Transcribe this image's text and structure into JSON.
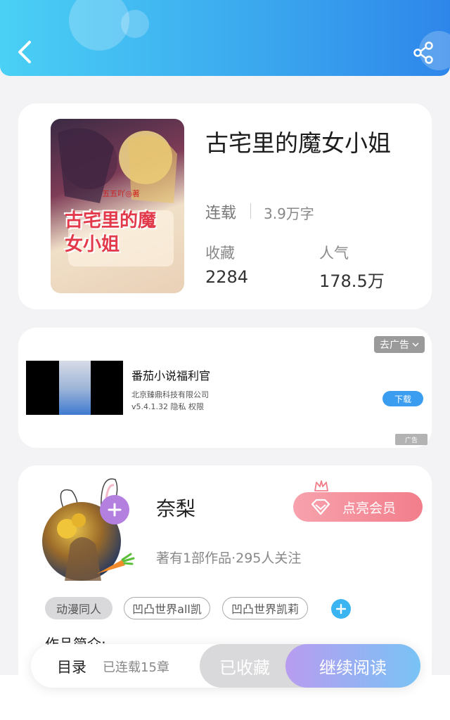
{
  "header": {
    "back_icon": "chevron-left-icon",
    "share_icon": "share-icon",
    "gradient": [
      "#4ad0f5",
      "#2e86ea"
    ]
  },
  "book": {
    "cover_title_art": "古宅里的魔女小姐",
    "cover_author_art": "五五吖◎著",
    "title": "古宅里的魔女小姐",
    "status": "连载",
    "word_count": "3.9万字",
    "collect_label": "收藏",
    "collect_value": "2284",
    "popularity_label": "人气",
    "popularity_value": "178.5万"
  },
  "ad": {
    "dismiss_label": "去广告",
    "title": "番茄小说福利官",
    "company": "北京臻鼎科技有限公司",
    "version_info": "v5.4.1.32  隐私  权限",
    "download_label": "下载",
    "ad_mark": "广告"
  },
  "author": {
    "name": "奈梨",
    "info": "著有1部作品·295人关注",
    "vip_label": "点亮会员",
    "tags": [
      "动漫同人",
      "凹凸世界all凯",
      "凹凸世界凯莉"
    ],
    "intro_title": "作品简介:"
  },
  "bottom_bar": {
    "toc_label": "目录",
    "chapter_count": "已连载15章",
    "collected_label": "已收藏",
    "read_label": "继续阅读"
  }
}
